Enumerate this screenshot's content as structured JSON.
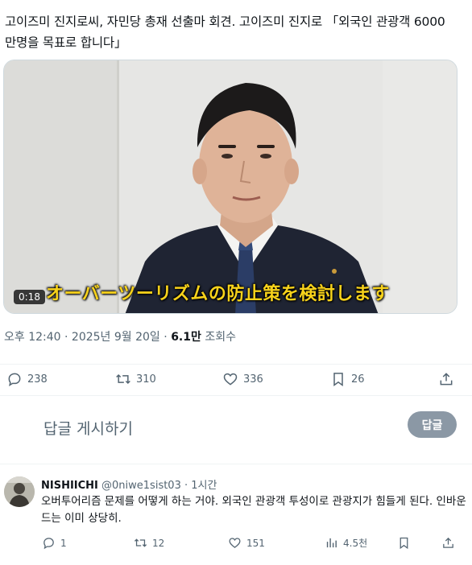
{
  "tweet": {
    "text": "고이즈미 진지로씨, 자민당 총재 선출마 회견. 고이즈미 진지로 「외국인 관광객 6000만명을 목표로 합니다」",
    "video": {
      "subtitle": "オーバーツーリズムの防止策を検討します",
      "timestamp": "0:18"
    },
    "meta": {
      "time": "오후 12:40",
      "separator": " · ",
      "date": "2025년 9월 20일",
      "views_count": "6.1만",
      "views_label": " 조회수"
    },
    "actions": {
      "replies": "238",
      "reposts": "310",
      "likes": "336",
      "bookmarks": "26"
    }
  },
  "reply_box": {
    "placeholder": "답글 게시하기",
    "button_label": "답글"
  },
  "reply": {
    "name": "NISHIICHI",
    "handle": "@0niwe1sist03",
    "time": "· 1시간",
    "text": "오버투어리즘 문제를 어떻게 하는 거야. 외국인 관광객 투성이로 관광지가 힘들게 된다. 인바운드는 이미 상당히.",
    "actions": {
      "replies": "1",
      "reposts": "12",
      "likes": "151",
      "views": "4.5천"
    }
  },
  "icons": {
    "reply": "speech-bubble-icon",
    "repost": "repost-arrows-icon",
    "like": "heart-icon",
    "bookmark": "bookmark-icon",
    "share": "share-upload-icon",
    "views": "bar-chart-icon"
  },
  "colors": {
    "text_primary": "#0f1419",
    "text_secondary": "#536471",
    "reply_button_bg": "#8b98a5",
    "subtitle_yellow": "#f7d21b"
  }
}
